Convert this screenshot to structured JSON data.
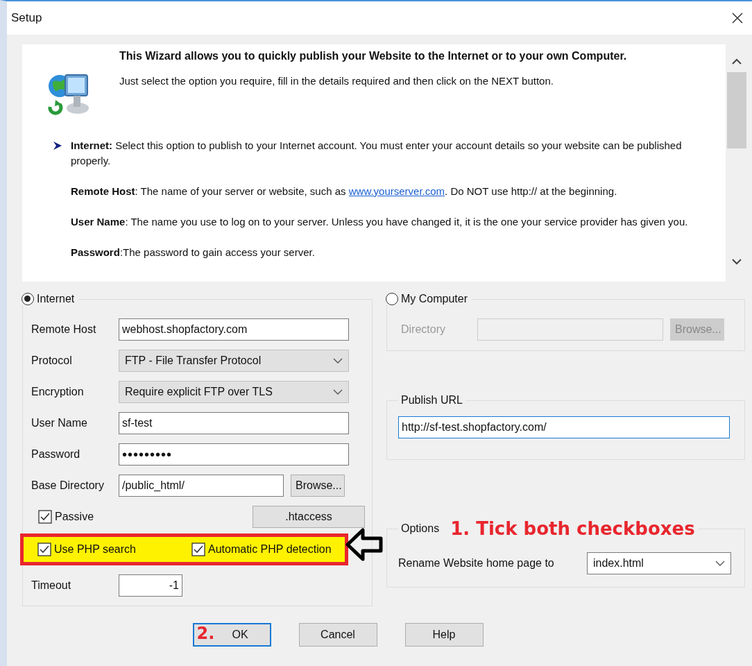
{
  "window": {
    "title": "Setup"
  },
  "info": {
    "heading": "This Wizard allows you to quickly publish your Website to the Internet or to your own Computer.",
    "intro": "Just select the option you require, fill in the details required and then click on the NEXT button.",
    "paragraphs": [
      {
        "kind": "bullet",
        "text": "**Internet:** Select this option to publish to your Internet account. You must enter your account details so your website can be published properly."
      },
      {
        "kind": "link",
        "text": "**Remote Host**: The name of your server or website, such as ",
        "link": "www.yourserver.com",
        "after": ". Do NOT use http:// at the beginning."
      },
      {
        "kind": "plain",
        "text": "**User Name**: The name you use to log on to your server. Unless you have changed it, it is the one your service provider has given you."
      },
      {
        "kind": "plain",
        "text": "**Password**:The password to gain access your server."
      }
    ]
  },
  "internet": {
    "label": "Internet",
    "selected": true,
    "fields": [
      {
        "kind": "text",
        "label": "Remote Host",
        "value": "webhost.shopfactory.com"
      },
      {
        "kind": "select",
        "label": "Protocol",
        "value": "FTP - File Transfer Protocol"
      },
      {
        "kind": "select",
        "label": "Encryption",
        "value": "Require explicit FTP over TLS"
      },
      {
        "kind": "text",
        "label": "User Name",
        "value": "sf-test"
      },
      {
        "kind": "text",
        "label": "Password",
        "value": "•••••••••"
      },
      {
        "kind": "browse",
        "label": "Base Directory",
        "value": "/public_html/",
        "button": "Browse..."
      }
    ],
    "passive": {
      "label": "Passive",
      "checked": true
    },
    "htaccess_button": ".htaccess",
    "php_options": [
      {
        "label": "Use PHP search",
        "checked": true
      },
      {
        "label": "Automatic PHP detection",
        "checked": true
      }
    ],
    "timeout": {
      "label": "Timeout",
      "value": "-1"
    }
  },
  "my_computer": {
    "label": "My Computer",
    "selected": false,
    "directory": {
      "label": "Directory",
      "button": "Browse...",
      "disabled": true
    }
  },
  "publish_url": {
    "legend": "Publish URL",
    "value": "http://sf-test.shopfactory.com/",
    "focused": true
  },
  "options": {
    "legend": "Options",
    "label": "Rename Website home page to",
    "value": "index.html"
  },
  "buttons": [
    {
      "label": "OK",
      "default": true
    },
    {
      "label": "Cancel",
      "default": false
    },
    {
      "label": "Help",
      "default": false
    }
  ],
  "annotations": {
    "step_1": "1. Tick both checkboxes",
    "step_2": "2."
  }
}
